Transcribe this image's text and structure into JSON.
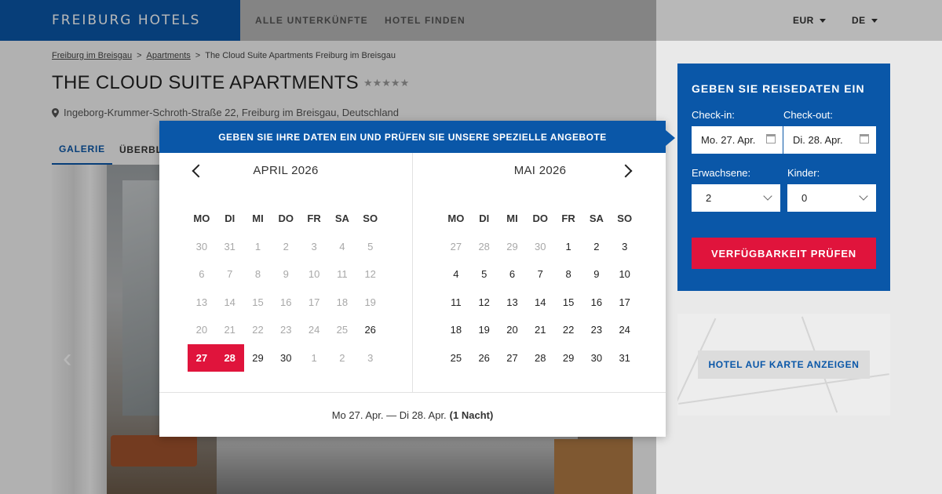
{
  "header": {
    "logo": "FREIBURG HOTELS",
    "nav": [
      "ALLE UNTERKÜNFTE",
      "HOTEL FINDEN"
    ],
    "currency": "EUR",
    "language": "DE"
  },
  "breadcrumb": {
    "home": "Freiburg im Breisgau",
    "sep1": ">",
    "section": "Apartments",
    "sep2": ">",
    "current": "The Cloud Suite Apartments Freiburg im Breisgau"
  },
  "hotel": {
    "title": "THE CLOUD SUITE APARTMENTS",
    "stars": "★★★★★",
    "address": "Ingeborg-Krummer-Schroth-Straße 22, Freiburg im Breisgau, Deutschland"
  },
  "tabs": [
    "GALERIE",
    "ÜBERBLICK"
  ],
  "booking": {
    "heading": "GEBEN SIE REISEDATEN EIN",
    "checkin_label": "Check-in:",
    "checkout_label": "Check-out:",
    "checkin_value": "Mo. 27. Apr.",
    "checkout_value": "Di. 28. Apr.",
    "adults_label": "Erwachsene:",
    "children_label": "Kinder:",
    "adults_value": "2",
    "children_value": "0",
    "button": "VERFÜGBARKEIT PRÜFEN"
  },
  "map": {
    "button": "HOTEL AUF KARTE ANZEIGEN"
  },
  "picker": {
    "heading": "GEBEN SIE IHRE DATEN EIN UND PRÜFEN SIE UNSERE SPEZIELLE ANGEBOTE",
    "weekdays": [
      "MO",
      "DI",
      "MI",
      "DO",
      "FR",
      "SA",
      "SO"
    ],
    "months": [
      {
        "title": "APRIL 2026",
        "weeks": [
          [
            {
              "d": "30",
              "m": 1
            },
            {
              "d": "31",
              "m": 1
            },
            {
              "d": "1",
              "m": 1
            },
            {
              "d": "2",
              "m": 1
            },
            {
              "d": "3",
              "m": 1
            },
            {
              "d": "4",
              "m": 1
            },
            {
              "d": "5",
              "m": 1
            }
          ],
          [
            {
              "d": "6",
              "m": 1
            },
            {
              "d": "7",
              "m": 1
            },
            {
              "d": "8",
              "m": 1
            },
            {
              "d": "9",
              "m": 1
            },
            {
              "d": "10",
              "m": 1
            },
            {
              "d": "11",
              "m": 1
            },
            {
              "d": "12",
              "m": 1
            }
          ],
          [
            {
              "d": "13",
              "m": 1
            },
            {
              "d": "14",
              "m": 1
            },
            {
              "d": "15",
              "m": 1
            },
            {
              "d": "16",
              "m": 1
            },
            {
              "d": "17",
              "m": 1
            },
            {
              "d": "18",
              "m": 1
            },
            {
              "d": "19",
              "m": 1
            }
          ],
          [
            {
              "d": "20",
              "m": 1
            },
            {
              "d": "21",
              "m": 1
            },
            {
              "d": "22",
              "m": 1
            },
            {
              "d": "23",
              "m": 1
            },
            {
              "d": "24",
              "m": 1
            },
            {
              "d": "25",
              "m": 1
            },
            {
              "d": "26",
              "m": 0
            }
          ],
          [
            {
              "d": "27",
              "m": 0,
              "s": 1
            },
            {
              "d": "28",
              "m": 0,
              "s": 1
            },
            {
              "d": "29",
              "m": 0
            },
            {
              "d": "30",
              "m": 0
            },
            {
              "d": "1",
              "m": 1
            },
            {
              "d": "2",
              "m": 1
            },
            {
              "d": "3",
              "m": 1
            }
          ]
        ]
      },
      {
        "title": "MAI 2026",
        "weeks": [
          [
            {
              "d": "27",
              "m": 1
            },
            {
              "d": "28",
              "m": 1
            },
            {
              "d": "29",
              "m": 1
            },
            {
              "d": "30",
              "m": 1
            },
            {
              "d": "1",
              "m": 0
            },
            {
              "d": "2",
              "m": 0
            },
            {
              "d": "3",
              "m": 0
            }
          ],
          [
            {
              "d": "4",
              "m": 0
            },
            {
              "d": "5",
              "m": 0
            },
            {
              "d": "6",
              "m": 0
            },
            {
              "d": "7",
              "m": 0
            },
            {
              "d": "8",
              "m": 0
            },
            {
              "d": "9",
              "m": 0
            },
            {
              "d": "10",
              "m": 0
            }
          ],
          [
            {
              "d": "11",
              "m": 0
            },
            {
              "d": "12",
              "m": 0
            },
            {
              "d": "13",
              "m": 0
            },
            {
              "d": "14",
              "m": 0
            },
            {
              "d": "15",
              "m": 0
            },
            {
              "d": "16",
              "m": 0
            },
            {
              "d": "17",
              "m": 0
            }
          ],
          [
            {
              "d": "18",
              "m": 0
            },
            {
              "d": "19",
              "m": 0
            },
            {
              "d": "20",
              "m": 0
            },
            {
              "d": "21",
              "m": 0
            },
            {
              "d": "22",
              "m": 0
            },
            {
              "d": "23",
              "m": 0
            },
            {
              "d": "24",
              "m": 0
            }
          ],
          [
            {
              "d": "25",
              "m": 0
            },
            {
              "d": "26",
              "m": 0
            },
            {
              "d": "27",
              "m": 0
            },
            {
              "d": "28",
              "m": 0
            },
            {
              "d": "29",
              "m": 0
            },
            {
              "d": "30",
              "m": 0
            },
            {
              "d": "31",
              "m": 0
            }
          ]
        ]
      }
    ],
    "summary_range": "Mo 27. Apr. — Di 28. Apr.",
    "summary_nights": "(1 Nacht)"
  },
  "icons": {
    "location": "map-pin-icon",
    "calendar": "calendar-icon",
    "prev": "chevron-left-icon",
    "next": "chevron-right-icon",
    "select": "chevron-down-icon"
  },
  "colors": {
    "brand_blue": "#0a57a8",
    "accent_red": "#e0143c"
  }
}
